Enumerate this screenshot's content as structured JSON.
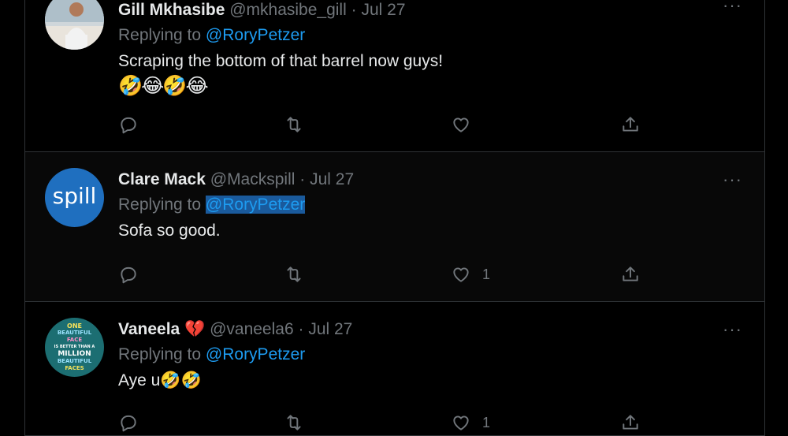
{
  "tweets": [
    {
      "name": "Gill Mkhasibe",
      "name_suffix": "",
      "handle": "@mkhasibe_gill",
      "date": "Jul 27",
      "replying_prefix": "Replying to",
      "replying_to": "@RoryPetzer",
      "text": "Scraping the bottom of that barrel now guys!",
      "emoji": "🤣😂🤣😂",
      "like_count": "",
      "more": "···"
    },
    {
      "name": "Clare Mack",
      "name_suffix": "",
      "handle": "@Mackspill",
      "date": "Jul 27",
      "avatar_text": "spill",
      "replying_prefix": "Replying to",
      "replying_to": "@RoryPetzer",
      "text": "Sofa so good.",
      "like_count": "1",
      "more": "···"
    },
    {
      "name": "Vaneela",
      "name_suffix": "💔",
      "handle": "@vaneela6",
      "date": "Jul 27",
      "avatar_lines": [
        "ONE",
        "BEAUTIFUL",
        "FACE",
        "IS BETTER THAN A",
        "MILLION",
        "BEAUTIFUL",
        "FACES"
      ],
      "replying_prefix": "Replying to",
      "replying_to": "@RoryPetzer",
      "text": "Aye u🤣🤣",
      "like_count": "1",
      "more": "···"
    }
  ],
  "separator": "·",
  "colors": {
    "background": "#000000",
    "text": "#e7e9ea",
    "muted": "#71767b",
    "link": "#1d9bf0",
    "border": "#2f3336",
    "avatar_spill": "#1f6fbf"
  },
  "icons": {
    "reply": "reply-icon",
    "retweet": "retweet-icon",
    "like": "heart-icon",
    "share": "share-icon",
    "more": "more-icon"
  }
}
